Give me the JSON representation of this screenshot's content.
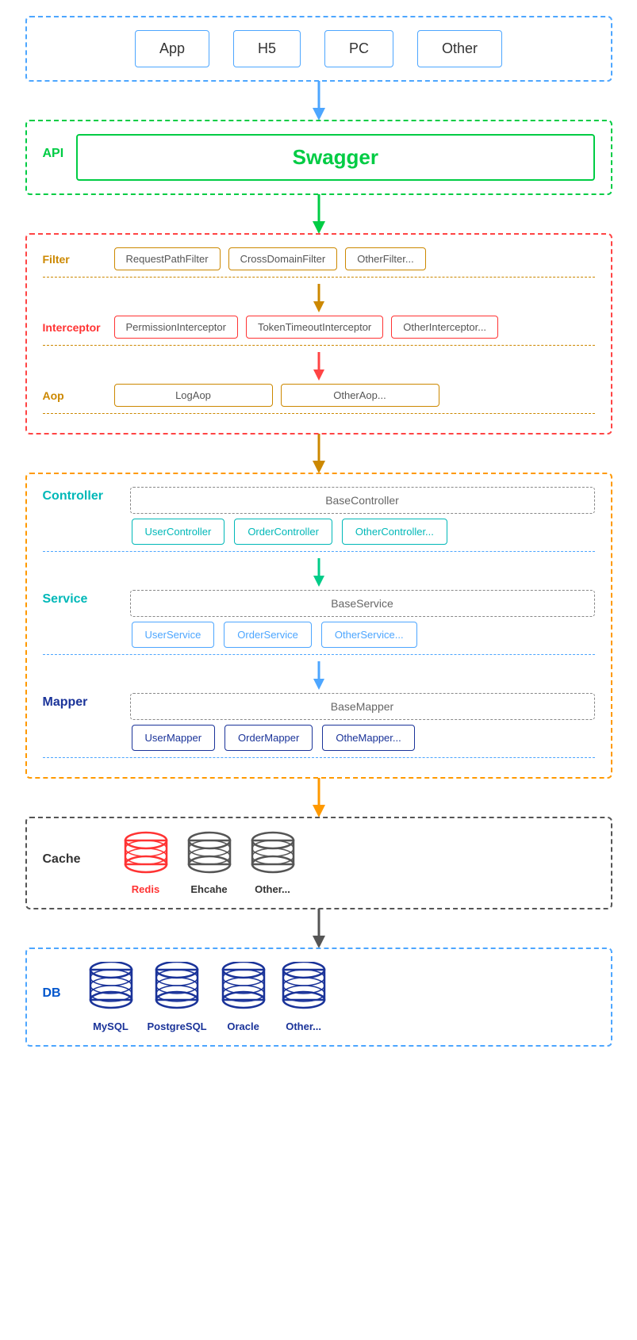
{
  "clients": {
    "boxes": [
      "App",
      "H5",
      "PC",
      "Other"
    ]
  },
  "api": {
    "label": "API",
    "swagger_label": "Swagger"
  },
  "filter": {
    "section_label": "Filter",
    "items": [
      "RequestPathFilter",
      "CrossDomainFilter",
      "OtherFilter..."
    ],
    "interceptor_label": "Interceptor",
    "interceptor_items": [
      "PermissionInterceptor",
      "TokenTimeoutInterceptor",
      "OtherInterceptor..."
    ],
    "aop_label": "Aop",
    "aop_items": [
      "LogAop",
      "OtherAop..."
    ]
  },
  "controller": {
    "label": "Controller",
    "base": "BaseController",
    "items": [
      "UserController",
      "OrderController",
      "OtherController..."
    ]
  },
  "service": {
    "label": "Service",
    "base": "BaseService",
    "items": [
      "UserService",
      "OrderService",
      "OtherService..."
    ]
  },
  "mapper": {
    "label": "Mapper",
    "base": "BaseMapper",
    "items": [
      "UserMapper",
      "OrderMapper",
      "OtheMapper..."
    ]
  },
  "cache": {
    "label": "Cache",
    "items": [
      {
        "name": "Redis",
        "color": "red"
      },
      {
        "name": "Ehcahe",
        "color": "dark"
      },
      {
        "name": "Other...",
        "color": "dark"
      }
    ]
  },
  "db": {
    "label": "DB",
    "items": [
      {
        "name": "MySQL",
        "color": "blue"
      },
      {
        "name": "PostgreSQL",
        "color": "blue"
      },
      {
        "name": "Oracle",
        "color": "blue"
      },
      {
        "name": "Other...",
        "color": "blue"
      }
    ]
  },
  "arrows": {
    "blue": "▼",
    "green": "▼",
    "orange": "▼",
    "red": "▼",
    "dark": "▼"
  }
}
